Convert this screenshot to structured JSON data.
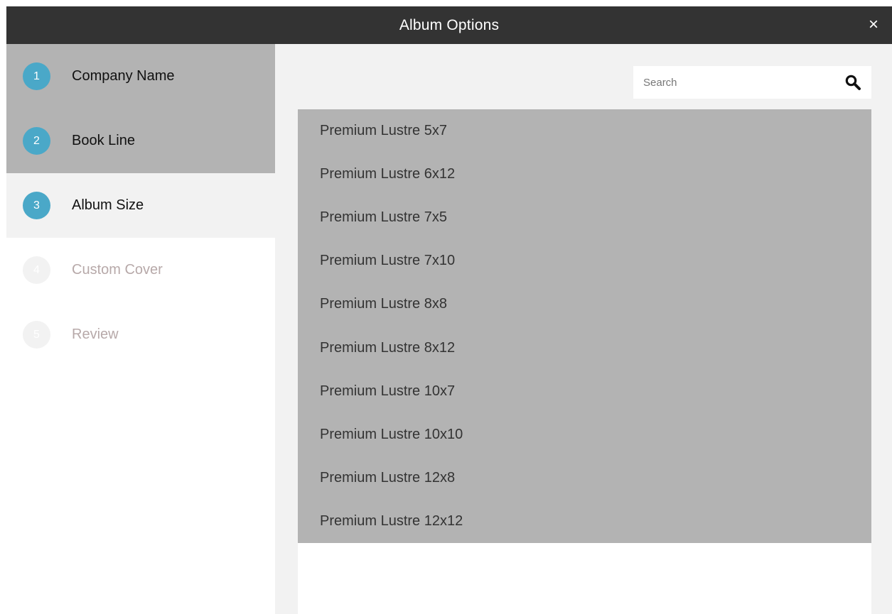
{
  "window": {
    "title": "Album Options",
    "close_glyph": "×"
  },
  "steps": [
    {
      "number": "1",
      "label": "Company Name",
      "state": "done"
    },
    {
      "number": "2",
      "label": "Book Line",
      "state": "done"
    },
    {
      "number": "3",
      "label": "Album Size",
      "state": "current"
    },
    {
      "number": "4",
      "label": "Custom Cover",
      "state": "pending"
    },
    {
      "number": "5",
      "label": "Review",
      "state": "pending"
    }
  ],
  "search": {
    "placeholder": "Search",
    "value": "",
    "icon": "search-icon"
  },
  "sizes": [
    "Premium Lustre 5x7",
    "Premium Lustre 6x12",
    "Premium Lustre 7x5",
    "Premium Lustre 7x10",
    "Premium Lustre 8x8",
    "Premium Lustre 8x12",
    "Premium Lustre 10x7",
    "Premium Lustre 10x10",
    "Premium Lustre 12x8",
    "Premium Lustre 12x12"
  ],
  "colors": {
    "titlebar": "#333333",
    "step_accent": "#4aa8c8",
    "done_bg": "#b3b3b3",
    "panel_bg": "#f2f2f2"
  }
}
